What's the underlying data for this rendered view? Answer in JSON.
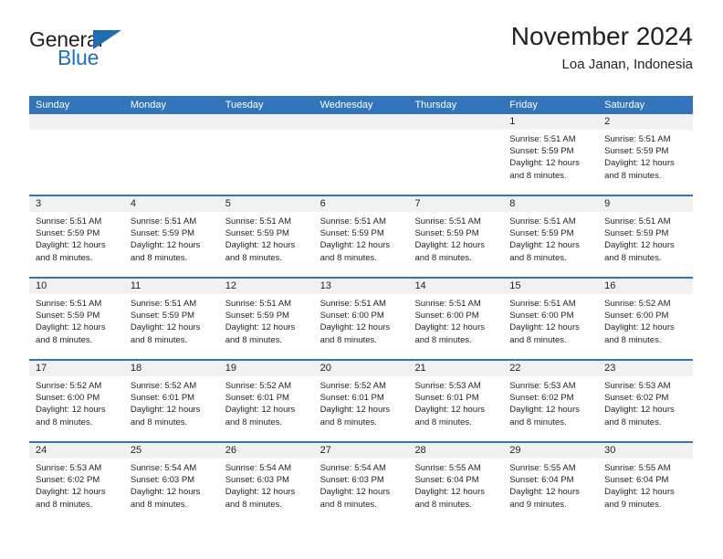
{
  "logo": {
    "word_one": "General",
    "word_two": "Blue",
    "triangle_icon": "triangle-icon",
    "brand_color": "#1f72bd",
    "text_color": "#231f20"
  },
  "header": {
    "title": "November 2024",
    "subtitle": "Loa Janan, Indonesia"
  },
  "calendar": {
    "header_bg": "#3275ba",
    "header_text_color": "#ffffff",
    "date_band_bg": "#f1f1f1",
    "weekdays": [
      "Sunday",
      "Monday",
      "Tuesday",
      "Wednesday",
      "Thursday",
      "Friday",
      "Saturday"
    ],
    "weeks": [
      [
        {
          "day": "",
          "empty": true
        },
        {
          "day": "",
          "empty": true
        },
        {
          "day": "",
          "empty": true
        },
        {
          "day": "",
          "empty": true
        },
        {
          "day": "",
          "empty": true
        },
        {
          "day": "1",
          "sunrise": "Sunrise: 5:51 AM",
          "sunset": "Sunset: 5:59 PM",
          "daylight": "Daylight: 12 hours and 8 minutes."
        },
        {
          "day": "2",
          "sunrise": "Sunrise: 5:51 AM",
          "sunset": "Sunset: 5:59 PM",
          "daylight": "Daylight: 12 hours and 8 minutes."
        }
      ],
      [
        {
          "day": "3",
          "sunrise": "Sunrise: 5:51 AM",
          "sunset": "Sunset: 5:59 PM",
          "daylight": "Daylight: 12 hours and 8 minutes."
        },
        {
          "day": "4",
          "sunrise": "Sunrise: 5:51 AM",
          "sunset": "Sunset: 5:59 PM",
          "daylight": "Daylight: 12 hours and 8 minutes."
        },
        {
          "day": "5",
          "sunrise": "Sunrise: 5:51 AM",
          "sunset": "Sunset: 5:59 PM",
          "daylight": "Daylight: 12 hours and 8 minutes."
        },
        {
          "day": "6",
          "sunrise": "Sunrise: 5:51 AM",
          "sunset": "Sunset: 5:59 PM",
          "daylight": "Daylight: 12 hours and 8 minutes."
        },
        {
          "day": "7",
          "sunrise": "Sunrise: 5:51 AM",
          "sunset": "Sunset: 5:59 PM",
          "daylight": "Daylight: 12 hours and 8 minutes."
        },
        {
          "day": "8",
          "sunrise": "Sunrise: 5:51 AM",
          "sunset": "Sunset: 5:59 PM",
          "daylight": "Daylight: 12 hours and 8 minutes."
        },
        {
          "day": "9",
          "sunrise": "Sunrise: 5:51 AM",
          "sunset": "Sunset: 5:59 PM",
          "daylight": "Daylight: 12 hours and 8 minutes."
        }
      ],
      [
        {
          "day": "10",
          "sunrise": "Sunrise: 5:51 AM",
          "sunset": "Sunset: 5:59 PM",
          "daylight": "Daylight: 12 hours and 8 minutes."
        },
        {
          "day": "11",
          "sunrise": "Sunrise: 5:51 AM",
          "sunset": "Sunset: 5:59 PM",
          "daylight": "Daylight: 12 hours and 8 minutes."
        },
        {
          "day": "12",
          "sunrise": "Sunrise: 5:51 AM",
          "sunset": "Sunset: 5:59 PM",
          "daylight": "Daylight: 12 hours and 8 minutes."
        },
        {
          "day": "13",
          "sunrise": "Sunrise: 5:51 AM",
          "sunset": "Sunset: 6:00 PM",
          "daylight": "Daylight: 12 hours and 8 minutes."
        },
        {
          "day": "14",
          "sunrise": "Sunrise: 5:51 AM",
          "sunset": "Sunset: 6:00 PM",
          "daylight": "Daylight: 12 hours and 8 minutes."
        },
        {
          "day": "15",
          "sunrise": "Sunrise: 5:51 AM",
          "sunset": "Sunset: 6:00 PM",
          "daylight": "Daylight: 12 hours and 8 minutes."
        },
        {
          "day": "16",
          "sunrise": "Sunrise: 5:52 AM",
          "sunset": "Sunset: 6:00 PM",
          "daylight": "Daylight: 12 hours and 8 minutes."
        }
      ],
      [
        {
          "day": "17",
          "sunrise": "Sunrise: 5:52 AM",
          "sunset": "Sunset: 6:00 PM",
          "daylight": "Daylight: 12 hours and 8 minutes."
        },
        {
          "day": "18",
          "sunrise": "Sunrise: 5:52 AM",
          "sunset": "Sunset: 6:01 PM",
          "daylight": "Daylight: 12 hours and 8 minutes."
        },
        {
          "day": "19",
          "sunrise": "Sunrise: 5:52 AM",
          "sunset": "Sunset: 6:01 PM",
          "daylight": "Daylight: 12 hours and 8 minutes."
        },
        {
          "day": "20",
          "sunrise": "Sunrise: 5:52 AM",
          "sunset": "Sunset: 6:01 PM",
          "daylight": "Daylight: 12 hours and 8 minutes."
        },
        {
          "day": "21",
          "sunrise": "Sunrise: 5:53 AM",
          "sunset": "Sunset: 6:01 PM",
          "daylight": "Daylight: 12 hours and 8 minutes."
        },
        {
          "day": "22",
          "sunrise": "Sunrise: 5:53 AM",
          "sunset": "Sunset: 6:02 PM",
          "daylight": "Daylight: 12 hours and 8 minutes."
        },
        {
          "day": "23",
          "sunrise": "Sunrise: 5:53 AM",
          "sunset": "Sunset: 6:02 PM",
          "daylight": "Daylight: 12 hours and 8 minutes."
        }
      ],
      [
        {
          "day": "24",
          "sunrise": "Sunrise: 5:53 AM",
          "sunset": "Sunset: 6:02 PM",
          "daylight": "Daylight: 12 hours and 8 minutes."
        },
        {
          "day": "25",
          "sunrise": "Sunrise: 5:54 AM",
          "sunset": "Sunset: 6:03 PM",
          "daylight": "Daylight: 12 hours and 8 minutes."
        },
        {
          "day": "26",
          "sunrise": "Sunrise: 5:54 AM",
          "sunset": "Sunset: 6:03 PM",
          "daylight": "Daylight: 12 hours and 8 minutes."
        },
        {
          "day": "27",
          "sunrise": "Sunrise: 5:54 AM",
          "sunset": "Sunset: 6:03 PM",
          "daylight": "Daylight: 12 hours and 8 minutes."
        },
        {
          "day": "28",
          "sunrise": "Sunrise: 5:55 AM",
          "sunset": "Sunset: 6:04 PM",
          "daylight": "Daylight: 12 hours and 8 minutes."
        },
        {
          "day": "29",
          "sunrise": "Sunrise: 5:55 AM",
          "sunset": "Sunset: 6:04 PM",
          "daylight": "Daylight: 12 hours and 9 minutes."
        },
        {
          "day": "30",
          "sunrise": "Sunrise: 5:55 AM",
          "sunset": "Sunset: 6:04 PM",
          "daylight": "Daylight: 12 hours and 9 minutes."
        }
      ]
    ]
  }
}
